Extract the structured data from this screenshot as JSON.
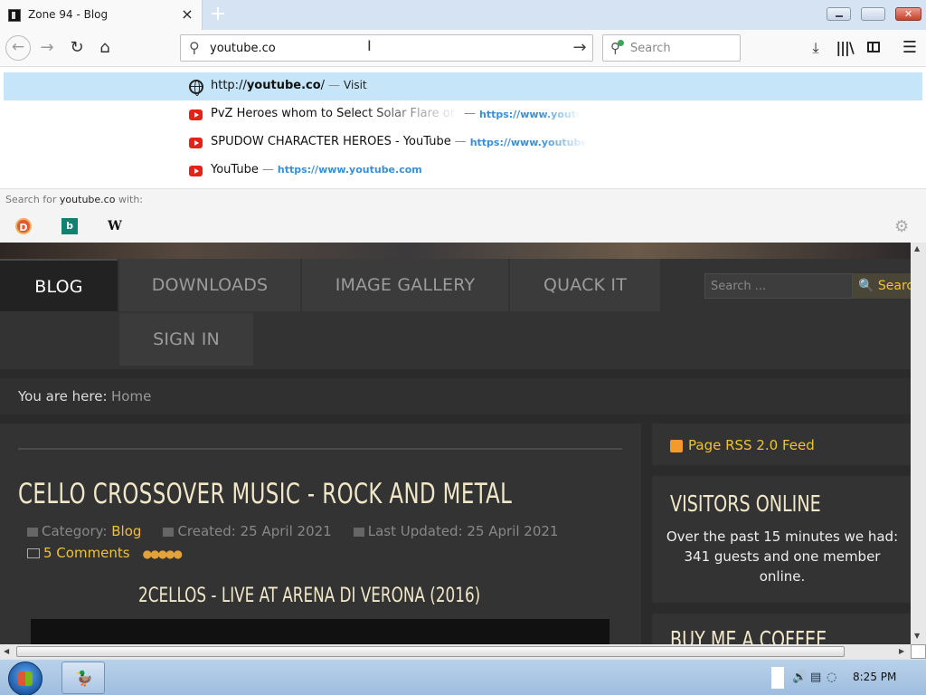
{
  "browser": {
    "tab_title": "Zone 94 - Blog",
    "tab_close": "×",
    "new_tab": "+",
    "window_min": "",
    "window_max": "",
    "window_close": "✕",
    "back": "←",
    "forward": "→",
    "reload": "↻",
    "home": "⌂",
    "url_value": "youtube.co",
    "url_go": "→",
    "search_placeholder": "Search",
    "downloads": "⤓",
    "library": "|||\\",
    "menu": "☰"
  },
  "dropdown": {
    "visit_item": {
      "prefix": "http://",
      "domain": "youtube.co",
      "suffix": "/",
      "sep": "—",
      "action": "Visit"
    },
    "results": [
      {
        "title": "PvZ Heroes whom to Select Solar Flare or Spudow",
        "sep": "—",
        "url": "https://www.youtube.com"
      },
      {
        "title": "SPUDOW CHARACTER HEROES - YouTube",
        "sep": "—",
        "url": "https://www.youtube.com"
      },
      {
        "title": "YouTube",
        "sep": "—",
        "url": "https://www.youtube.com"
      }
    ],
    "search_for_prefix": "Search for ",
    "search_for_term": "youtube.co",
    "search_for_suffix": " with:",
    "engines": [
      {
        "icon": "duckduckgo-icon",
        "glyph": "D"
      },
      {
        "icon": "bing-icon",
        "glyph": "b"
      },
      {
        "icon": "wikipedia-icon",
        "glyph": "W"
      }
    ],
    "settings": "⚙"
  },
  "site": {
    "menu": [
      {
        "label": "BLOG"
      },
      {
        "label": "DOWNLOADS"
      },
      {
        "label": "IMAGE GALLERY"
      },
      {
        "label": "QUACK IT"
      },
      {
        "label": "SIGN IN"
      }
    ],
    "search_placeholder": "Search ...",
    "search_button": "🔍 Search",
    "breadcrumb_label": "You are here:",
    "breadcrumb_home": "Home",
    "article": {
      "title": "CELLO CROSSOVER MUSIC - ROCK AND METAL",
      "category_label": "Category:",
      "category": "Blog",
      "created": "Created: 25 April 2021",
      "updated": "Last Updated: 25 April 2021",
      "comments": "5 Comments",
      "rating": "●●●●●",
      "subheading": "2CELLOS - LIVE AT ARENA DI VERONA (2016)"
    },
    "sidebar": {
      "rss": "Page RSS 2.0 Feed",
      "visitors_heading": "VISITORS ONLINE",
      "visitors_text": "Over the past 15 minutes we had: 341 guests and one member online.",
      "coffee_heading": "BUY ME A COFFEE"
    }
  },
  "scroll": {
    "up": "▲",
    "down": "▼",
    "left": "◀",
    "right": "▶"
  },
  "taskbar": {
    "app_glyph": "🦆",
    "clock": "8:25 PM"
  },
  "colors": {
    "accent_gold": "#f1c232",
    "selection_blue": "#c6e5f8",
    "link_blue": "#3a8fd6"
  }
}
